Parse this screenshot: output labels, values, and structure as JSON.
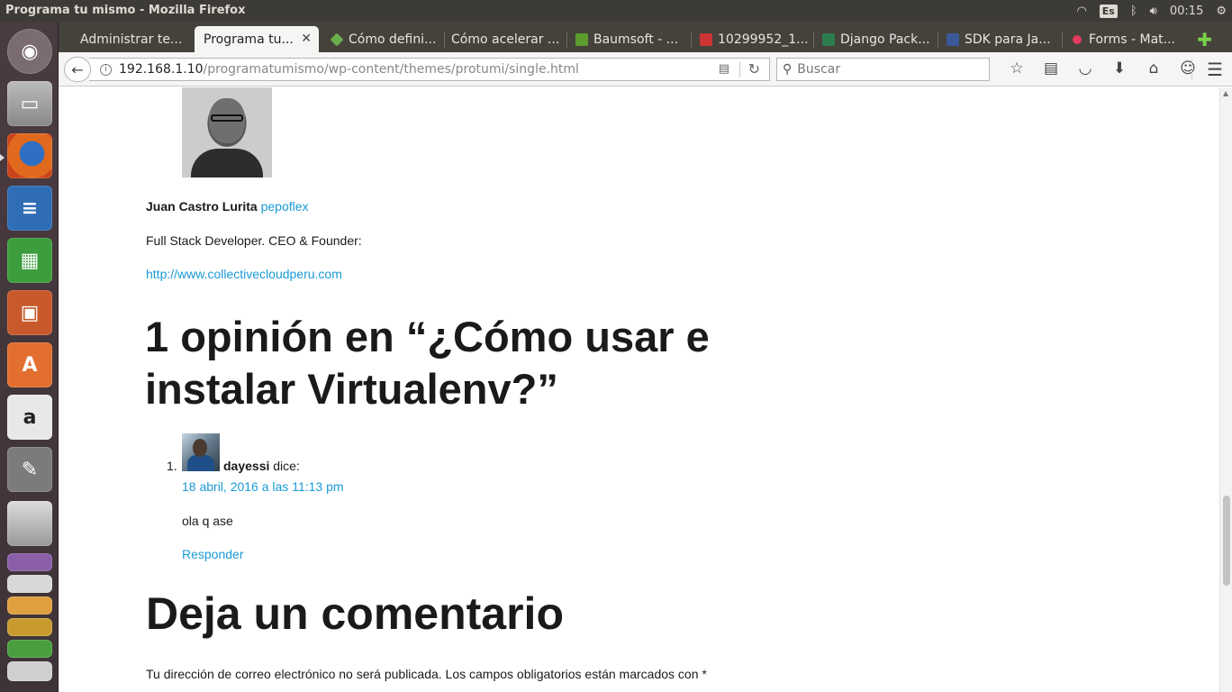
{
  "window_title": "Programa tu mismo - Mozilla Firefox",
  "tray": {
    "keyboard_layout": "Es",
    "clock": "00:15"
  },
  "tabs": [
    {
      "label": "Administrar te..."
    },
    {
      "label": "Programa tu...",
      "active": true
    },
    {
      "label": "Cómo defini..."
    },
    {
      "label": "Cómo acelerar ..."
    },
    {
      "label": "Baumsoft - ..."
    },
    {
      "label": "10299952_1..."
    },
    {
      "label": "Django Pack..."
    },
    {
      "label": "SDK para Ja..."
    },
    {
      "label": "Forms - Mat..."
    }
  ],
  "url": {
    "host": "192.168.1.10",
    "path": "/programatumismo/wp-content/themes/protumi/single.html"
  },
  "search": {
    "placeholder": "Buscar"
  },
  "author": {
    "name": "Juan Castro Lurita",
    "handle": "pepoflex",
    "description": "Full Stack Developer. CEO & Founder:",
    "website": "http://www.collectivecloudperu.com"
  },
  "comments_title": "1 opinión en “¿Cómo usar e instalar Virtualenv?”",
  "comments": [
    {
      "number": "1.",
      "author": "dayessi",
      "says": "dice:",
      "date": "18 abril, 2016 a las 11:13 pm",
      "text": "ola q ase",
      "reply": "Responder"
    }
  ],
  "leave_comment": {
    "title": "Deja un comentario",
    "notice": "Tu dirección de correo electrónico no será publicada. Los campos obligatorios están marcados con *"
  },
  "colors": {
    "link": "#1a9ad7",
    "panel": "#3c3b37",
    "launcher": "#4a3b3f"
  }
}
